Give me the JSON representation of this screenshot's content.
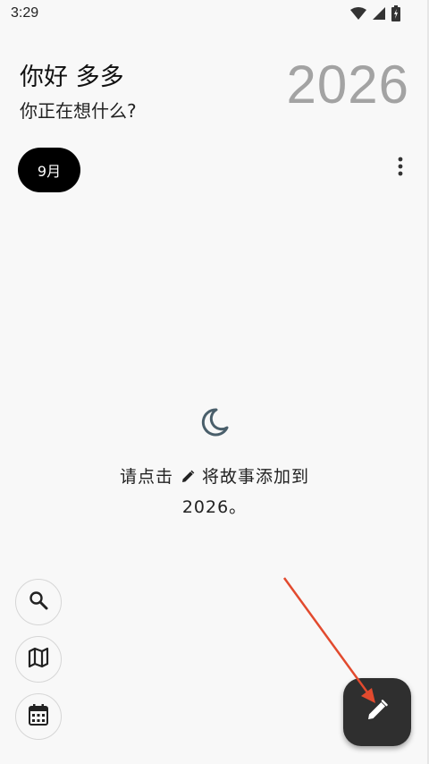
{
  "status_bar": {
    "time": "3:29"
  },
  "header": {
    "greeting": "你好 多多",
    "subtitle": "你正在想什么?",
    "year": "2026"
  },
  "month_chip": {
    "label": "9月"
  },
  "empty_state": {
    "line1_before": "请点击",
    "line1_after": "将故事添加到",
    "line2": "2026。"
  },
  "icons": {
    "empty_state": "moon-icon",
    "more": "more-vert-icon",
    "search": "search-icon",
    "map": "map-icon",
    "calendar": "calendar-icon",
    "fab": "pencil-icon"
  },
  "colors": {
    "background": "#f8f8f8",
    "chip_bg": "#000000",
    "fab_bg": "#2f2f2f",
    "year_text": "#a3a3a3",
    "moon_icon": "#4a5f6b",
    "annotation_arrow": "#e24a2e"
  }
}
